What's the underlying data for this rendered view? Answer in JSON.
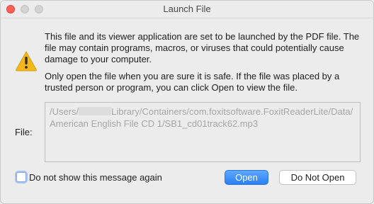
{
  "window": {
    "title": "Launch File"
  },
  "dialog": {
    "warning_icon": "warning-triangle-icon",
    "message_1": "This file and its viewer application are set to be launched by the PDF file. The file may contain programs, macros, or viruses that could potentially cause damage to your computer.",
    "message_2": "Only open the file when you are sure it is safe. If the file was placed by a trusted person or program, you can click Open to view the file.",
    "file_label": "File:",
    "file_path_prefix": "/Users/",
    "file_path_suffix": "Library/Containers/com.foxitsoftware.FoxitReaderLite/Data/American English File CD 1/SB1_cd01track62.mp3",
    "checkbox_label": "Do not show this message again",
    "checkbox_checked": false,
    "open_button": "Open",
    "do_not_open_button": "Do Not Open"
  },
  "colors": {
    "accent": "#2a7ff5",
    "close": "#fe5f57",
    "warning": "#f3b71b"
  }
}
